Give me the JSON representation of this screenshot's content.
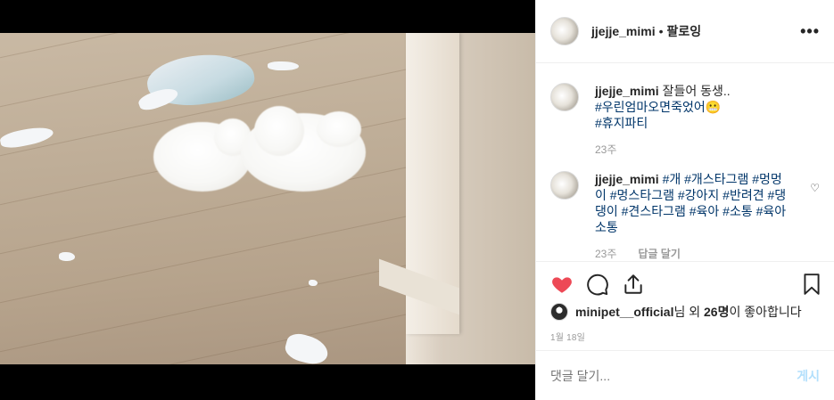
{
  "post": {
    "image_alt": "",
    "author": "jjejje_mimi",
    "follow_sep": "•",
    "follow_label": "팔로잉",
    "more_label": "•••"
  },
  "comments": [
    {
      "user": "jjejje_mimi",
      "lines": [
        "잘들어 동생..",
        "#우린엄마오면죽었어😬",
        "#휴지파티"
      ],
      "time": "23주"
    },
    {
      "user": "jjejje_mimi",
      "text": "#개 #개스타그램 #멍멍이 #멍스타그램 #강아지 #반려견 #댕댕이 #견스타그램 #육아 #소통 #육아소통",
      "time": "23주",
      "reply": "답글 달기"
    }
  ],
  "likes": {
    "user": "minipet__official",
    "suffix": "님 외 ",
    "count": "26명",
    "tail": "이 좋아합니다"
  },
  "date": "1월 18일",
  "composer": {
    "placeholder": "댓글 달기...",
    "post_label": "게시"
  },
  "colors": {
    "like": "#ed4956",
    "hashtag": "#003569",
    "post_disabled": "#b2dffc"
  },
  "icons": [
    "heart-icon",
    "comment-icon",
    "share-icon",
    "bookmark-icon",
    "more-icon"
  ]
}
